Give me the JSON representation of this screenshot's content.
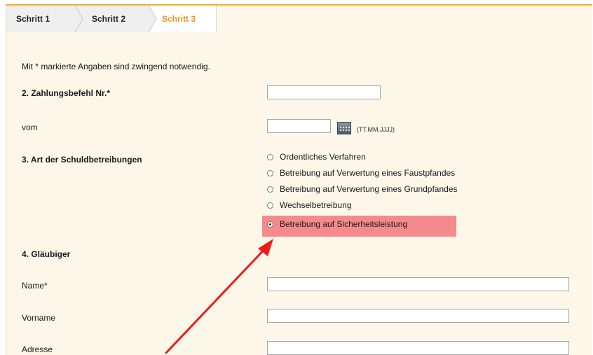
{
  "tabs": [
    {
      "label": "Schritt 1"
    },
    {
      "label": "Schritt 2"
    },
    {
      "label": "Schritt 3"
    }
  ],
  "info_text": "Mit * markierte Angaben sind zwingend notwendig.",
  "section2": {
    "label": "2. Zahlungsbefehl Nr.*",
    "value": ""
  },
  "vom": {
    "label": "vom",
    "value": "",
    "hint": "(TT.MM.JJJJ)"
  },
  "section3": {
    "label": "3. Art der Schuldbetreibungen",
    "options": [
      {
        "label": "Ordentliches Verfahren",
        "selected": false
      },
      {
        "label": "Betreibung auf Verwertung eines Faustpfandes",
        "selected": false
      },
      {
        "label": "Betreibung auf Verwertung eines Grundpfandes",
        "selected": false
      },
      {
        "label": "Wechselbetreibung",
        "selected": false
      },
      {
        "label": "Betreibung auf Sicherheitsleistung",
        "selected": true
      }
    ]
  },
  "section4": {
    "label": "4. Gläubiger",
    "fields": [
      {
        "label": "Name*",
        "value": ""
      },
      {
        "label": "Vorname",
        "value": ""
      },
      {
        "label": "Adresse",
        "value": ""
      }
    ]
  },
  "colors": {
    "accent": "#f2b12d",
    "active_tab": "#e8932c",
    "highlight": "#f58a8c",
    "arrow": "#ee1c1c",
    "background": "#fcf7e8"
  },
  "icons": {
    "calendar": "calendar-icon",
    "arrow": "annotation-arrow"
  }
}
